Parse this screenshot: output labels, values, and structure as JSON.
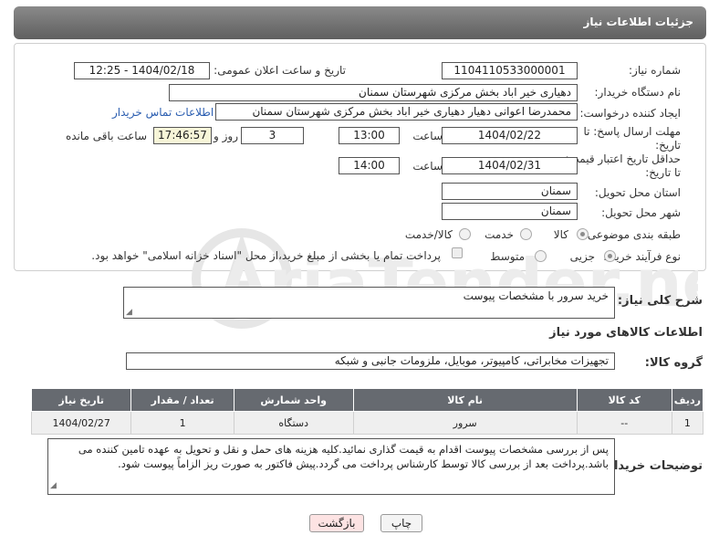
{
  "header": {
    "title": "جزئیات اطلاعات نیاز"
  },
  "form": {
    "need_number_label": "شماره نیاز:",
    "need_number": "1104110533000001",
    "announce_label": "تاریخ و ساعت اعلان عمومی:",
    "announce_value": "1404/02/18 - 12:25",
    "buyer_org_label": "نام دستگاه خریدار:",
    "buyer_org": "دهیاری خیر اباد بخش مرکزی شهرستان سمنان",
    "creator_label": "ایجاد کننده درخواست:",
    "creator": "محمدرضا اعوانی دهیار دهیاری خیر اباد بخش مرکزی شهرستان سمنان",
    "contact_link": "اطلاعات تماس خریدار",
    "reply_deadline_label": "مهلت ارسال پاسخ: تا تاریخ:",
    "reply_date": "1404/02/22",
    "time_label": "ساعت",
    "reply_time": "13:00",
    "days_value": "3",
    "days_label": "روز و",
    "remaining_time": "17:46:57",
    "remaining_label": "ساعت باقی مانده",
    "price_validity_label": "حداقل تاریخ اعتبار قیمت: تا تاریخ:",
    "validity_date": "1404/02/31",
    "validity_time": "14:00",
    "province_label": "استان محل تحویل:",
    "province": "سمنان",
    "city_label": "شهر محل تحویل:",
    "city": "سمنان",
    "category_label": "طبقه بندی موضوعی:",
    "category_options": [
      "کالا",
      "خدمت",
      "کالا/خدمت"
    ],
    "category_selected": "کالا",
    "process_label": "نوع فرآیند خرید :",
    "process_options": [
      "جزیی",
      "متوسط"
    ],
    "process_selected": "جزیی",
    "payment_note": "پرداخت تمام یا بخشی از مبلغ خرید،از محل \"اسناد خزانه اسلامی\" خواهد بود."
  },
  "description": {
    "label": "شرح کلی نیاز:",
    "value": "خرید سرور با مشخصات پیوست"
  },
  "goods": {
    "section_title": "اطلاعات کالاهای مورد نیاز",
    "group_label": "گروه کالا:",
    "group_value": "تجهیزات مخابراتی، کامپیوتر، موبایل، ملزومات جانبی و شبکه",
    "columns": [
      "ردیف",
      "کد کالا",
      "نام کالا",
      "واحد شمارش",
      "تعداد / مقدار",
      "تاریخ نیاز"
    ],
    "rows": [
      {
        "row": "1",
        "code": "--",
        "name": "سرور",
        "unit": "دستگاه",
        "qty": "1",
        "date": "1404/02/27"
      }
    ]
  },
  "buyer_notes": {
    "label": "توضیحات خریدار:",
    "line1": "پس از بررسی مشخصات پیوست اقدام به قیمت گذاری نمائید.کلیه هزینه های حمل و نقل  و تحویل به عهده تامین کننده می",
    "line2": "باشد.پرداخت بعد از بررسی کالا توسط کارشناس پرداخت می گردد.پیش فاکتور به صورت ریز الزاماً پیوست شود."
  },
  "buttons": {
    "print": "چاپ",
    "back": "بازگشت"
  },
  "watermark": {
    "text": "AriaTender.net"
  },
  "colors": {
    "header": "#6e6e6e",
    "link": "#2a5db0",
    "back_button": "#fde3e3",
    "table_header": "#666a70"
  }
}
